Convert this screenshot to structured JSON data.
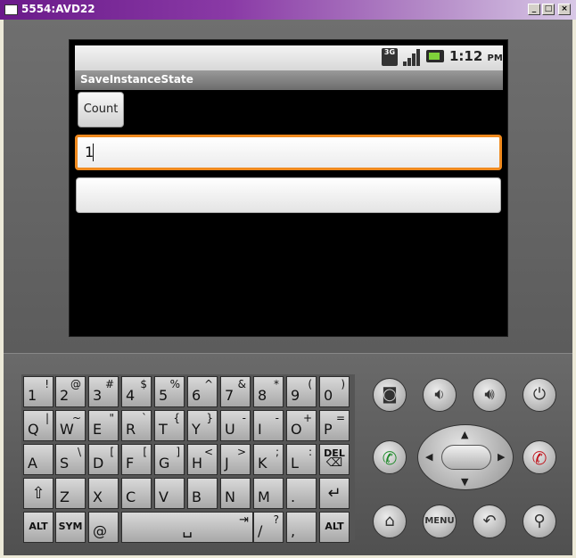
{
  "window": {
    "title": "5554:AVD22",
    "minimize": "_",
    "maximize": "□",
    "close": "×"
  },
  "status_bar": {
    "network": "3G",
    "time": "1:12",
    "ampm": "PM"
  },
  "app": {
    "title": "SaveInstanceState",
    "count_button": "Count",
    "field1_value": "1",
    "field2_value": ""
  },
  "keyboard": {
    "row1": [
      [
        "1",
        "!"
      ],
      [
        "2",
        "@"
      ],
      [
        "3",
        "#"
      ],
      [
        "4",
        "$"
      ],
      [
        "5",
        "%"
      ],
      [
        "6",
        "^"
      ],
      [
        "7",
        "&"
      ],
      [
        "8",
        "*"
      ],
      [
        "9",
        "("
      ],
      [
        "0",
        ")"
      ]
    ],
    "row2": [
      [
        "Q",
        "|"
      ],
      [
        "W",
        "~"
      ],
      [
        "E",
        "\""
      ],
      [
        "R",
        "`"
      ],
      [
        "T",
        "{"
      ],
      [
        "Y",
        "}"
      ],
      [
        "U",
        "-"
      ],
      [
        "I",
        "-"
      ],
      [
        "O",
        "+"
      ],
      [
        "P",
        "="
      ]
    ],
    "row3": [
      [
        "A",
        ""
      ],
      [
        "S",
        "\\"
      ],
      [
        "D",
        "["
      ],
      [
        "F",
        "["
      ],
      [
        "G",
        "]"
      ],
      [
        "H",
        "<"
      ],
      [
        "J",
        ">"
      ],
      [
        "K",
        ";"
      ],
      [
        "L",
        ":"
      ]
    ],
    "del": "DEL",
    "row4": [
      "Z",
      "X",
      "C",
      "V",
      "B",
      "N",
      "M",
      "."
    ],
    "alt": "ALT",
    "sym": "SYM",
    "at": "@",
    "slash": "/",
    "question": "?",
    "comma": ","
  },
  "controls": {
    "menu": "MENU"
  },
  "colors": {
    "focus_orange": "#f08a1e",
    "battery_green": "#7fd23a",
    "end_call_red": "#c0141c",
    "call_green": "#1f8a2a"
  }
}
